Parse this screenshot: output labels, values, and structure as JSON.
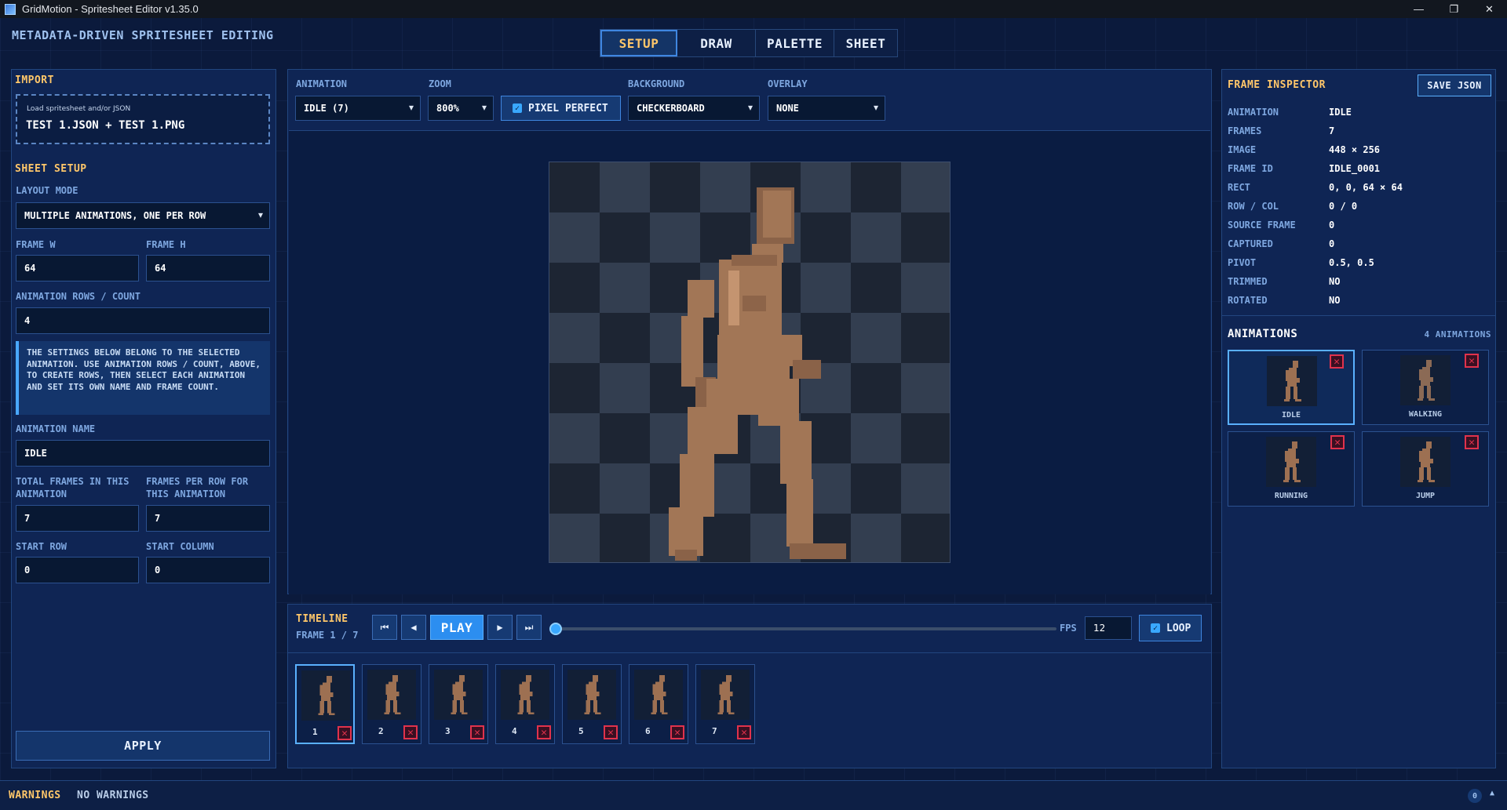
{
  "window": {
    "title": "GridMotion - Spritesheet Editor v1.35.0",
    "minimize": "—",
    "restore": "❐",
    "close": "✕"
  },
  "header": {
    "title": "METADATA-DRIVEN SPRITESHEET EDITING"
  },
  "tabs": [
    "SETUP",
    "DRAW",
    "PALETTE",
    "SHEET"
  ],
  "import": {
    "section": "IMPORT",
    "hint": "Load spritesheet and/or JSON",
    "files": "TEST 1.JSON + TEST 1.PNG"
  },
  "setup": {
    "section": "SHEET SETUP",
    "layout_label": "LAYOUT MODE",
    "layout_value": "MULTIPLE ANIMATIONS, ONE PER ROW",
    "frame_w_label": "FRAME W",
    "frame_w": "64",
    "frame_h_label": "FRAME H",
    "frame_h": "64",
    "rows_label": "ANIMATION ROWS / COUNT",
    "rows": "4",
    "note": "THE SETTINGS BELOW BELONG TO THE SELECTED ANIMATION. USE ANIMATION ROWS / COUNT, ABOVE, TO CREATE ROWS, THEN SELECT EACH ANIMATION AND SET ITS OWN NAME AND FRAME COUNT.",
    "anim_name_label": "ANIMATION NAME",
    "anim_name": "IDLE",
    "total_frames_label": "TOTAL FRAMES IN THIS ANIMATION",
    "total_frames": "7",
    "frames_per_row_label": "FRAMES PER ROW FOR THIS ANIMATION",
    "frames_per_row": "7",
    "start_row_label": "START ROW",
    "start_row": "0",
    "start_col_label": "START COLUMN",
    "start_col": "0",
    "apply": "APPLY"
  },
  "toolbar": {
    "animation_label": "ANIMATION",
    "animation_value": "IDLE (7)",
    "zoom_label": "ZOOM",
    "zoom_value": "800%",
    "pixel_perfect": "PIXEL PERFECT",
    "background_label": "BACKGROUND",
    "background_value": "CHECKERBOARD",
    "overlay_label": "OVERLAY",
    "overlay_value": "NONE"
  },
  "timeline": {
    "title": "TIMELINE",
    "frame_info": "FRAME 1 / 7",
    "play": "PLAY",
    "fps_label": "FPS",
    "fps": "12",
    "loop": "LOOP",
    "progress": 0,
    "frames": [
      "1",
      "2",
      "3",
      "4",
      "5",
      "6",
      "7"
    ]
  },
  "inspector": {
    "title": "FRAME INSPECTOR",
    "save": "SAVE JSON",
    "rows": [
      {
        "k": "ANIMATION",
        "v": "IDLE"
      },
      {
        "k": "FRAMES",
        "v": "7"
      },
      {
        "k": "IMAGE",
        "v": "448 × 256"
      },
      {
        "k": "FRAME ID",
        "v": "IDLE_0001"
      },
      {
        "k": "RECT",
        "v": "0, 0, 64 × 64"
      },
      {
        "k": "ROW / COL",
        "v": "0 / 0"
      },
      {
        "k": "SOURCE FRAME",
        "v": "0"
      },
      {
        "k": "CAPTURED",
        "v": "0"
      },
      {
        "k": "PIVOT",
        "v": "0.5, 0.5"
      },
      {
        "k": "TRIMMED",
        "v": "NO"
      },
      {
        "k": "ROTATED",
        "v": "NO"
      }
    ]
  },
  "animations": {
    "title": "ANIMATIONS",
    "count": "4 ANIMATIONS",
    "items": [
      "IDLE",
      "WALKING",
      "RUNNING",
      "JUMP"
    ]
  },
  "status": {
    "warnings_label": "WARNINGS",
    "warnings_value": "NO WARNINGS",
    "badge": "0"
  },
  "colors": {
    "accent": "#39a8ff",
    "section": "#ffc76a",
    "danger": "#e0324c",
    "panel": "#0f2554"
  }
}
